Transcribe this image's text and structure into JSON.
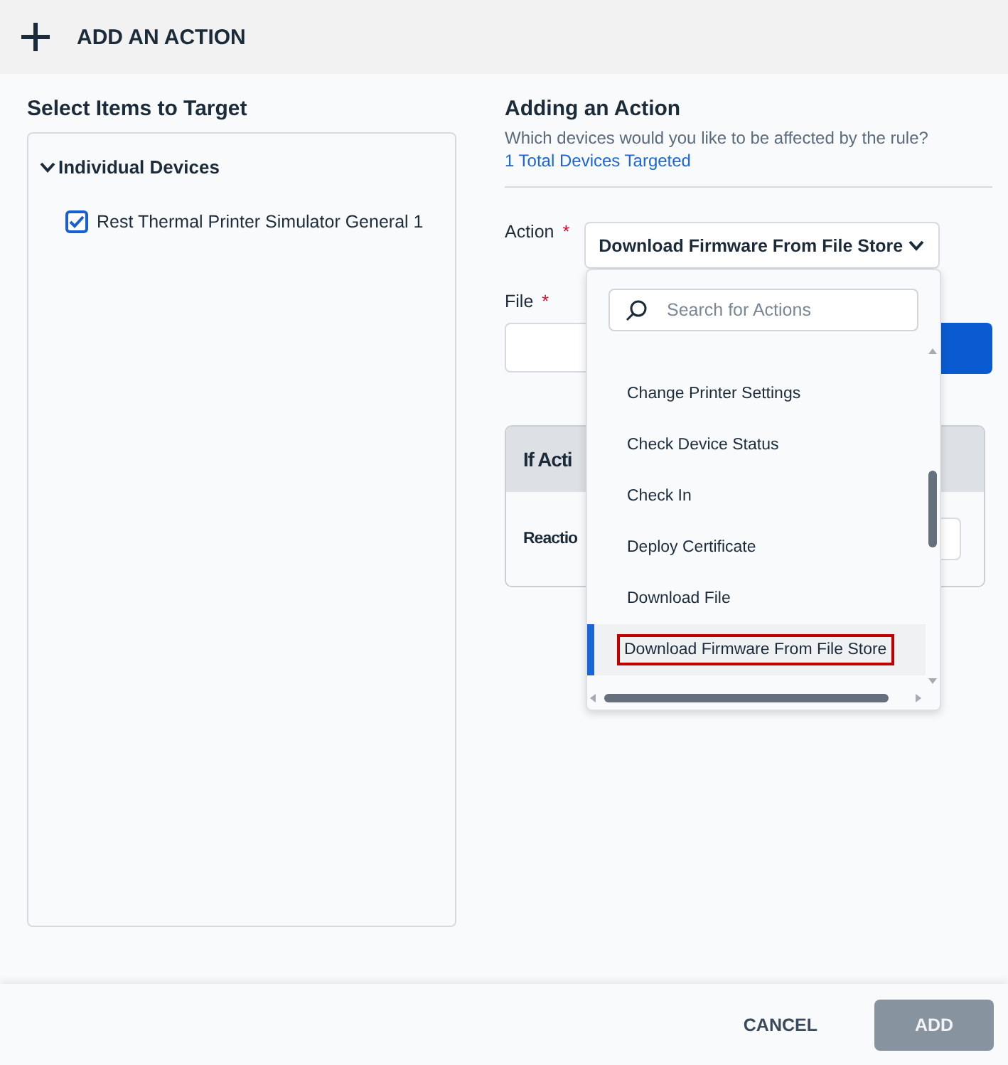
{
  "header": {
    "title": "ADD AN ACTION"
  },
  "targets": {
    "title": "Select Items to Target",
    "group": {
      "label": "Individual Devices",
      "expanded": true,
      "items": [
        {
          "label": "Rest Thermal Printer Simulator General 1",
          "checked": true
        }
      ]
    }
  },
  "action_panel": {
    "title": "Adding an Action",
    "subtitle": "Which devices would you like to be affected by the rule?",
    "link": "1 Total Devices Targeted",
    "action": {
      "label": "Action",
      "required_mark": "*",
      "value": "Download Firmware From File Store"
    },
    "file": {
      "label": "File",
      "required_mark": "*"
    },
    "card": {
      "title": "If Acti",
      "row_label": "Reactio"
    }
  },
  "dropdown": {
    "placeholder": "Search for Actions",
    "options": [
      {
        "label": "Change Printer Settings",
        "selected": false
      },
      {
        "label": "Check Device Status",
        "selected": false
      },
      {
        "label": "Check In",
        "selected": false
      },
      {
        "label": "Deploy Certificate",
        "selected": false
      },
      {
        "label": "Download File",
        "selected": false
      },
      {
        "label": "Download Firmware From File Store",
        "selected": true
      }
    ]
  },
  "footer": {
    "buttons": [
      {
        "label": "CANCEL",
        "kind": "text",
        "disabled": false
      },
      {
        "label": "ADD",
        "kind": "primary",
        "disabled": true
      }
    ]
  }
}
